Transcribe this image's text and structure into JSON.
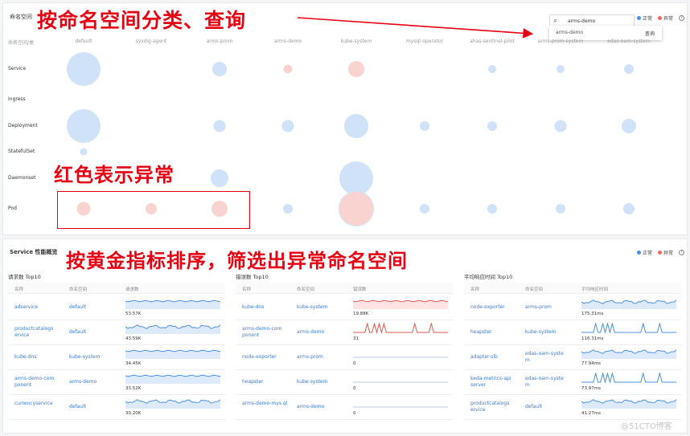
{
  "top": {
    "title": "命名空间",
    "annotation": "按命名空间分类、查询",
    "search": {
      "value": "arms-demo",
      "icon": "search-icon"
    },
    "dropdown": {
      "option": "arms-demo",
      "action": "查询"
    },
    "legend": {
      "ok": "正常",
      "err": "异常",
      "help": "?",
      "ok_color": "#4a90e2",
      "err_color": "#f5675d"
    },
    "row_header": "命名空间/类",
    "namespaces": [
      "default",
      "sysdig-agent",
      "arms-prom",
      "arms-demo",
      "kube-system",
      "mysql-operator",
      "ahas-sentinel-pilot",
      "arms-prom-system",
      "edas-oam-system"
    ],
    "rows": [
      "Service",
      "Ingress",
      "Deployment",
      "StatefulSet",
      "Daemonset",
      "Pod"
    ],
    "annotation_mid": "红色表示异常",
    "bubbles": [
      {
        "row": 0,
        "col": 0,
        "size": 42,
        "status": "ok"
      },
      {
        "row": 0,
        "col": 2,
        "size": 18,
        "status": "ok"
      },
      {
        "row": 0,
        "col": 3,
        "size": 11,
        "status": "err"
      },
      {
        "row": 0,
        "col": 4,
        "size": 20,
        "status": "err"
      },
      {
        "row": 0,
        "col": 6,
        "size": 10,
        "status": "ok"
      },
      {
        "row": 0,
        "col": 7,
        "size": 10,
        "status": "ok"
      },
      {
        "row": 0,
        "col": 8,
        "size": 12,
        "status": "ok"
      },
      {
        "row": 2,
        "col": 0,
        "size": 42,
        "status": "ok"
      },
      {
        "row": 2,
        "col": 2,
        "size": 15,
        "status": "ok"
      },
      {
        "row": 2,
        "col": 3,
        "size": 15,
        "status": "ok"
      },
      {
        "row": 2,
        "col": 4,
        "size": 30,
        "status": "ok"
      },
      {
        "row": 2,
        "col": 5,
        "size": 12,
        "status": "ok"
      },
      {
        "row": 2,
        "col": 6,
        "size": 12,
        "status": "ok"
      },
      {
        "row": 2,
        "col": 7,
        "size": 15,
        "status": "ok"
      },
      {
        "row": 2,
        "col": 8,
        "size": 18,
        "status": "ok"
      },
      {
        "row": 3,
        "col": 0,
        "size": 9,
        "status": "ok"
      },
      {
        "row": 4,
        "col": 2,
        "size": 22,
        "status": "ok"
      },
      {
        "row": 4,
        "col": 4,
        "size": 42,
        "status": "ok"
      },
      {
        "row": 5,
        "col": 0,
        "size": 17,
        "status": "err"
      },
      {
        "row": 5,
        "col": 1,
        "size": 14,
        "status": "err"
      },
      {
        "row": 5,
        "col": 2,
        "size": 20,
        "status": "err"
      },
      {
        "row": 5,
        "col": 3,
        "size": 12,
        "status": "ok"
      },
      {
        "row": 5,
        "col": 4,
        "size": 42,
        "status": "err"
      },
      {
        "row": 5,
        "col": 5,
        "size": 12,
        "status": "ok"
      },
      {
        "row": 5,
        "col": 6,
        "size": 12,
        "status": "ok"
      },
      {
        "row": 5,
        "col": 7,
        "size": 12,
        "status": "ok"
      },
      {
        "row": 5,
        "col": 8,
        "size": 14,
        "status": "ok"
      }
    ]
  },
  "bottom": {
    "title": "Service 性能概览",
    "annotation": "按黄金指标排序，筛选出异常命名空间",
    "legend": {
      "ok": "正常",
      "err": "异常",
      "help": "?"
    },
    "tables": [
      {
        "title": "请求数 Top10",
        "headers": [
          "名称",
          "命名空间",
          "请求数"
        ],
        "rows": [
          {
            "name": "adservice",
            "ns": "default",
            "value": "53.57K",
            "spark": "flat",
            "color": "#4a90e2"
          },
          {
            "name": "productcatalogs ervice",
            "ns": "default",
            "value": "43.59K",
            "spark": "wave",
            "color": "#4a90e2"
          },
          {
            "name": "kube-dns",
            "ns": "kube-system",
            "value": "34.45K",
            "spark": "flat",
            "color": "#4a90e2"
          },
          {
            "name": "arms-demo-com ponent",
            "ns": "arms-demo",
            "value": "33.52K",
            "spark": "flat",
            "color": "#4a90e2"
          },
          {
            "name": "currencyservice",
            "ns": "default",
            "value": "30.20K",
            "spark": "wave",
            "color": "#4a90e2"
          }
        ]
      },
      {
        "title": "错误数 Top10",
        "headers": [
          "名称",
          "命名空间",
          "错误数"
        ],
        "rows": [
          {
            "name": "kube-dns",
            "ns": "kube-system",
            "value": "19.88K",
            "spark": "flat",
            "color": "#e05a4f"
          },
          {
            "name": "arms-demo-com ponent",
            "ns": "arms-demo",
            "value": "31",
            "spark": "spikes",
            "color": "#e05a4f"
          },
          {
            "name": "node-exporter",
            "ns": "arms-prom",
            "value": "0",
            "spark": "zero",
            "color": "#4a90e2"
          },
          {
            "name": "heapster",
            "ns": "kube-system",
            "value": "0",
            "spark": "zero",
            "color": "#4a90e2"
          },
          {
            "name": "arms-demo-mys ql",
            "ns": "arms-demo",
            "value": "0",
            "spark": "zero",
            "color": "#4a90e2"
          }
        ]
      },
      {
        "title": "平均响应时间 Top10",
        "headers": [
          "名称",
          "命名空间",
          "平均响应时间"
        ],
        "rows": [
          {
            "name": "node-exporter",
            "ns": "arms-prom",
            "value": "175.31ms",
            "spark": "wave",
            "color": "#4a90e2"
          },
          {
            "name": "heapster",
            "ns": "kube-system",
            "value": "116.31ms",
            "spark": "spikes",
            "color": "#4a90e2"
          },
          {
            "name": "adapter-slb",
            "ns": "edas-oam-syste m",
            "value": "77.94ms",
            "spark": "wave",
            "color": "#4a90e2"
          },
          {
            "name": "keda-metrics-api server",
            "ns": "edas-oam-syste m",
            "value": "73.97ms",
            "spark": "spikes",
            "color": "#4a90e2"
          },
          {
            "name": "productcatalogs ervice",
            "ns": "default",
            "value": "41.27ms",
            "spark": "wave",
            "color": "#4a90e2"
          }
        ]
      }
    ]
  },
  "watermark": "@51CTO博客"
}
